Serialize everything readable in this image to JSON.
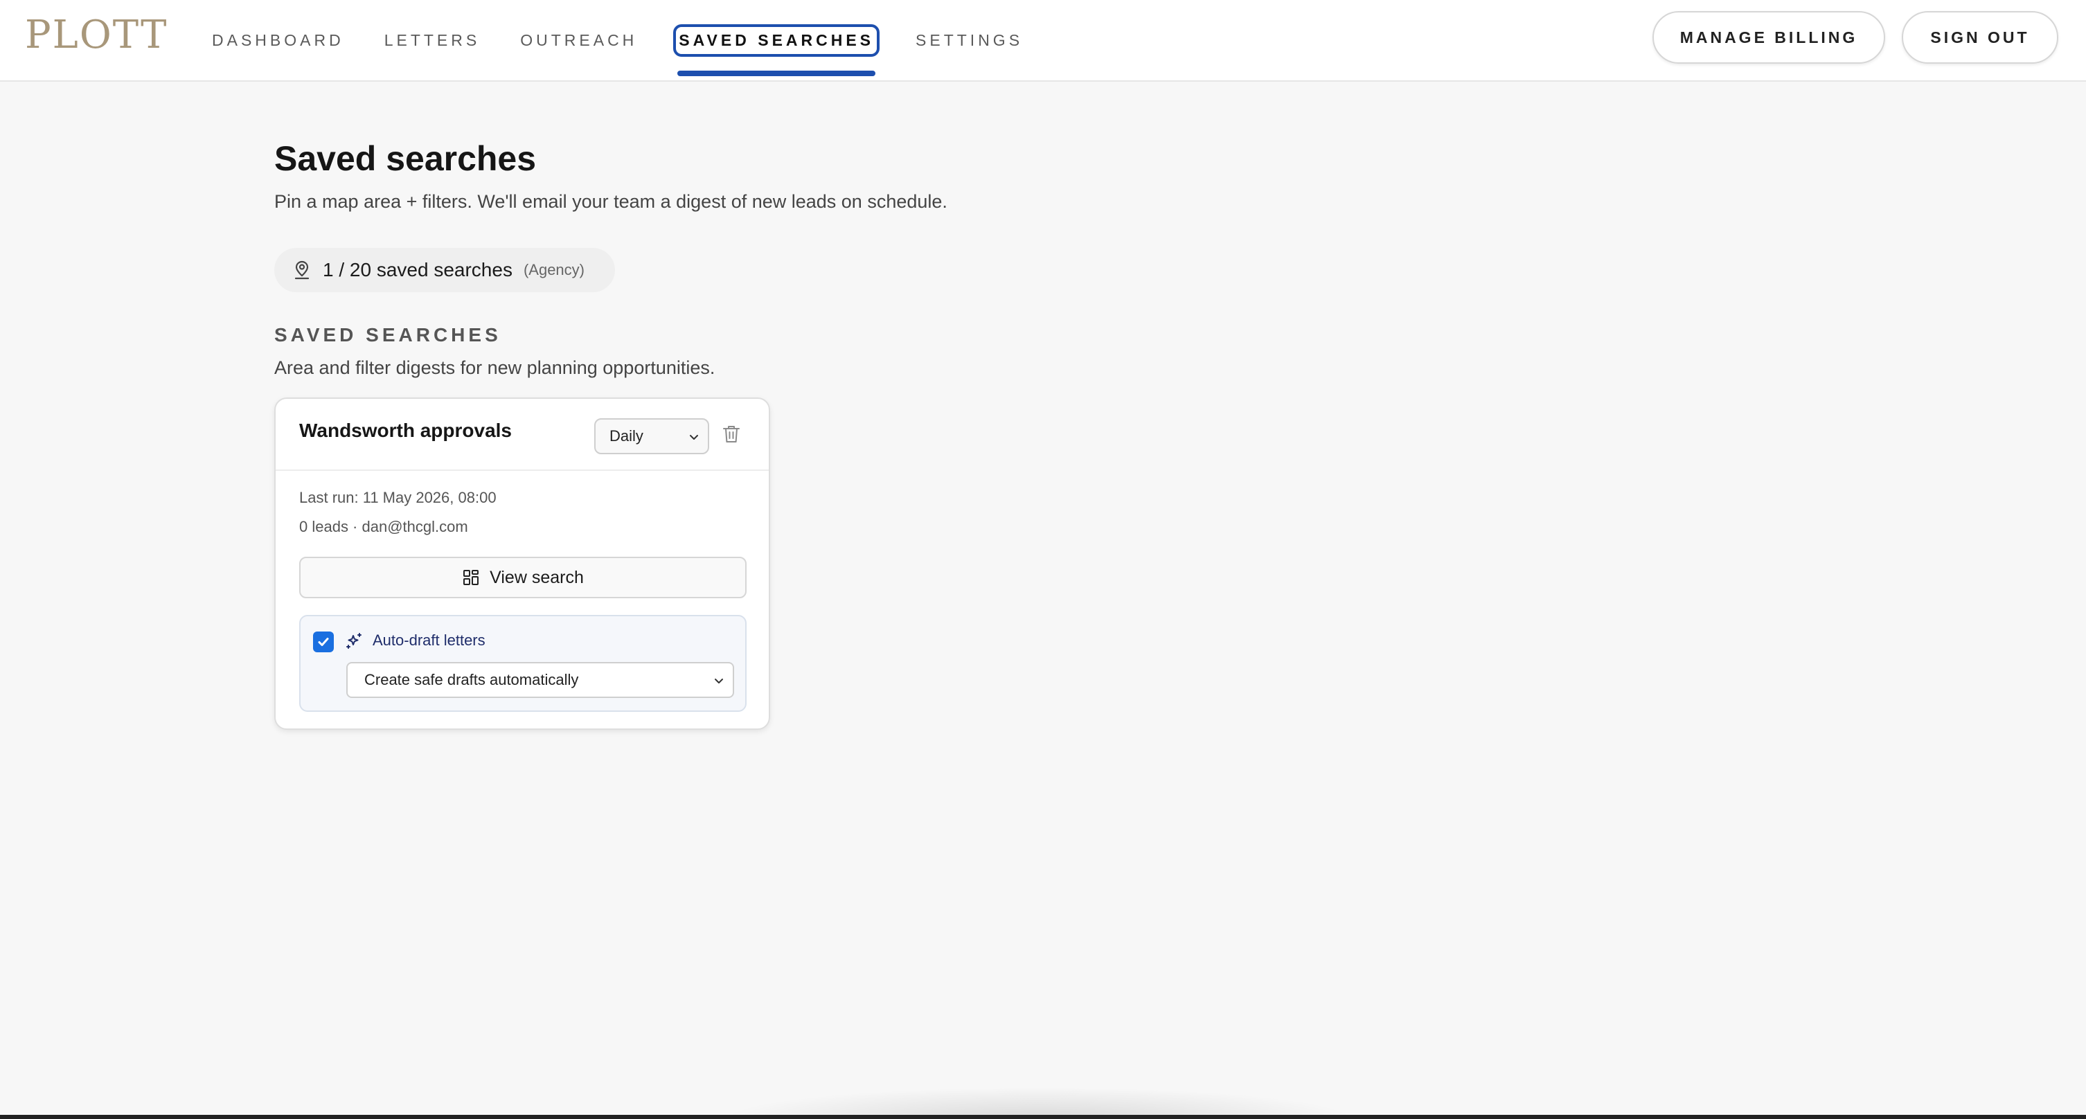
{
  "brand": {
    "logo": "PLOTT"
  },
  "nav": {
    "items": [
      {
        "label": "DASHBOARD",
        "active": false
      },
      {
        "label": "LETTERS",
        "active": false
      },
      {
        "label": "OUTREACH",
        "active": false
      },
      {
        "label": "SAVED SEARCHES",
        "active": true
      },
      {
        "label": "SETTINGS",
        "active": false
      }
    ],
    "manage_billing": "MANAGE BILLING",
    "sign_out": "SIGN OUT"
  },
  "page": {
    "title": "Saved searches",
    "subtitle": "Pin a map area + filters. We'll email your team a digest of new leads on schedule.",
    "quota": {
      "text": "1 / 20 saved searches",
      "tier": "(Agency)"
    },
    "section_heading": "SAVED SEARCHES",
    "section_subtitle": "Area and filter digests for new planning opportunities."
  },
  "card": {
    "title": "Wandsworth approvals",
    "frequency": "Daily",
    "last_run": "Last run: 11 May 2026, 08:00",
    "leads": "0 leads · dan@thcgl.com",
    "view_button": "View search",
    "auto_draft": {
      "checked": true,
      "label": "Auto-draft letters",
      "mode": "Create safe drafts automatically"
    }
  },
  "colors": {
    "accent": "#1d4fae",
    "logo": "#a8977a",
    "checkbox": "#1a6fe0",
    "background": "#f7f7f7"
  }
}
